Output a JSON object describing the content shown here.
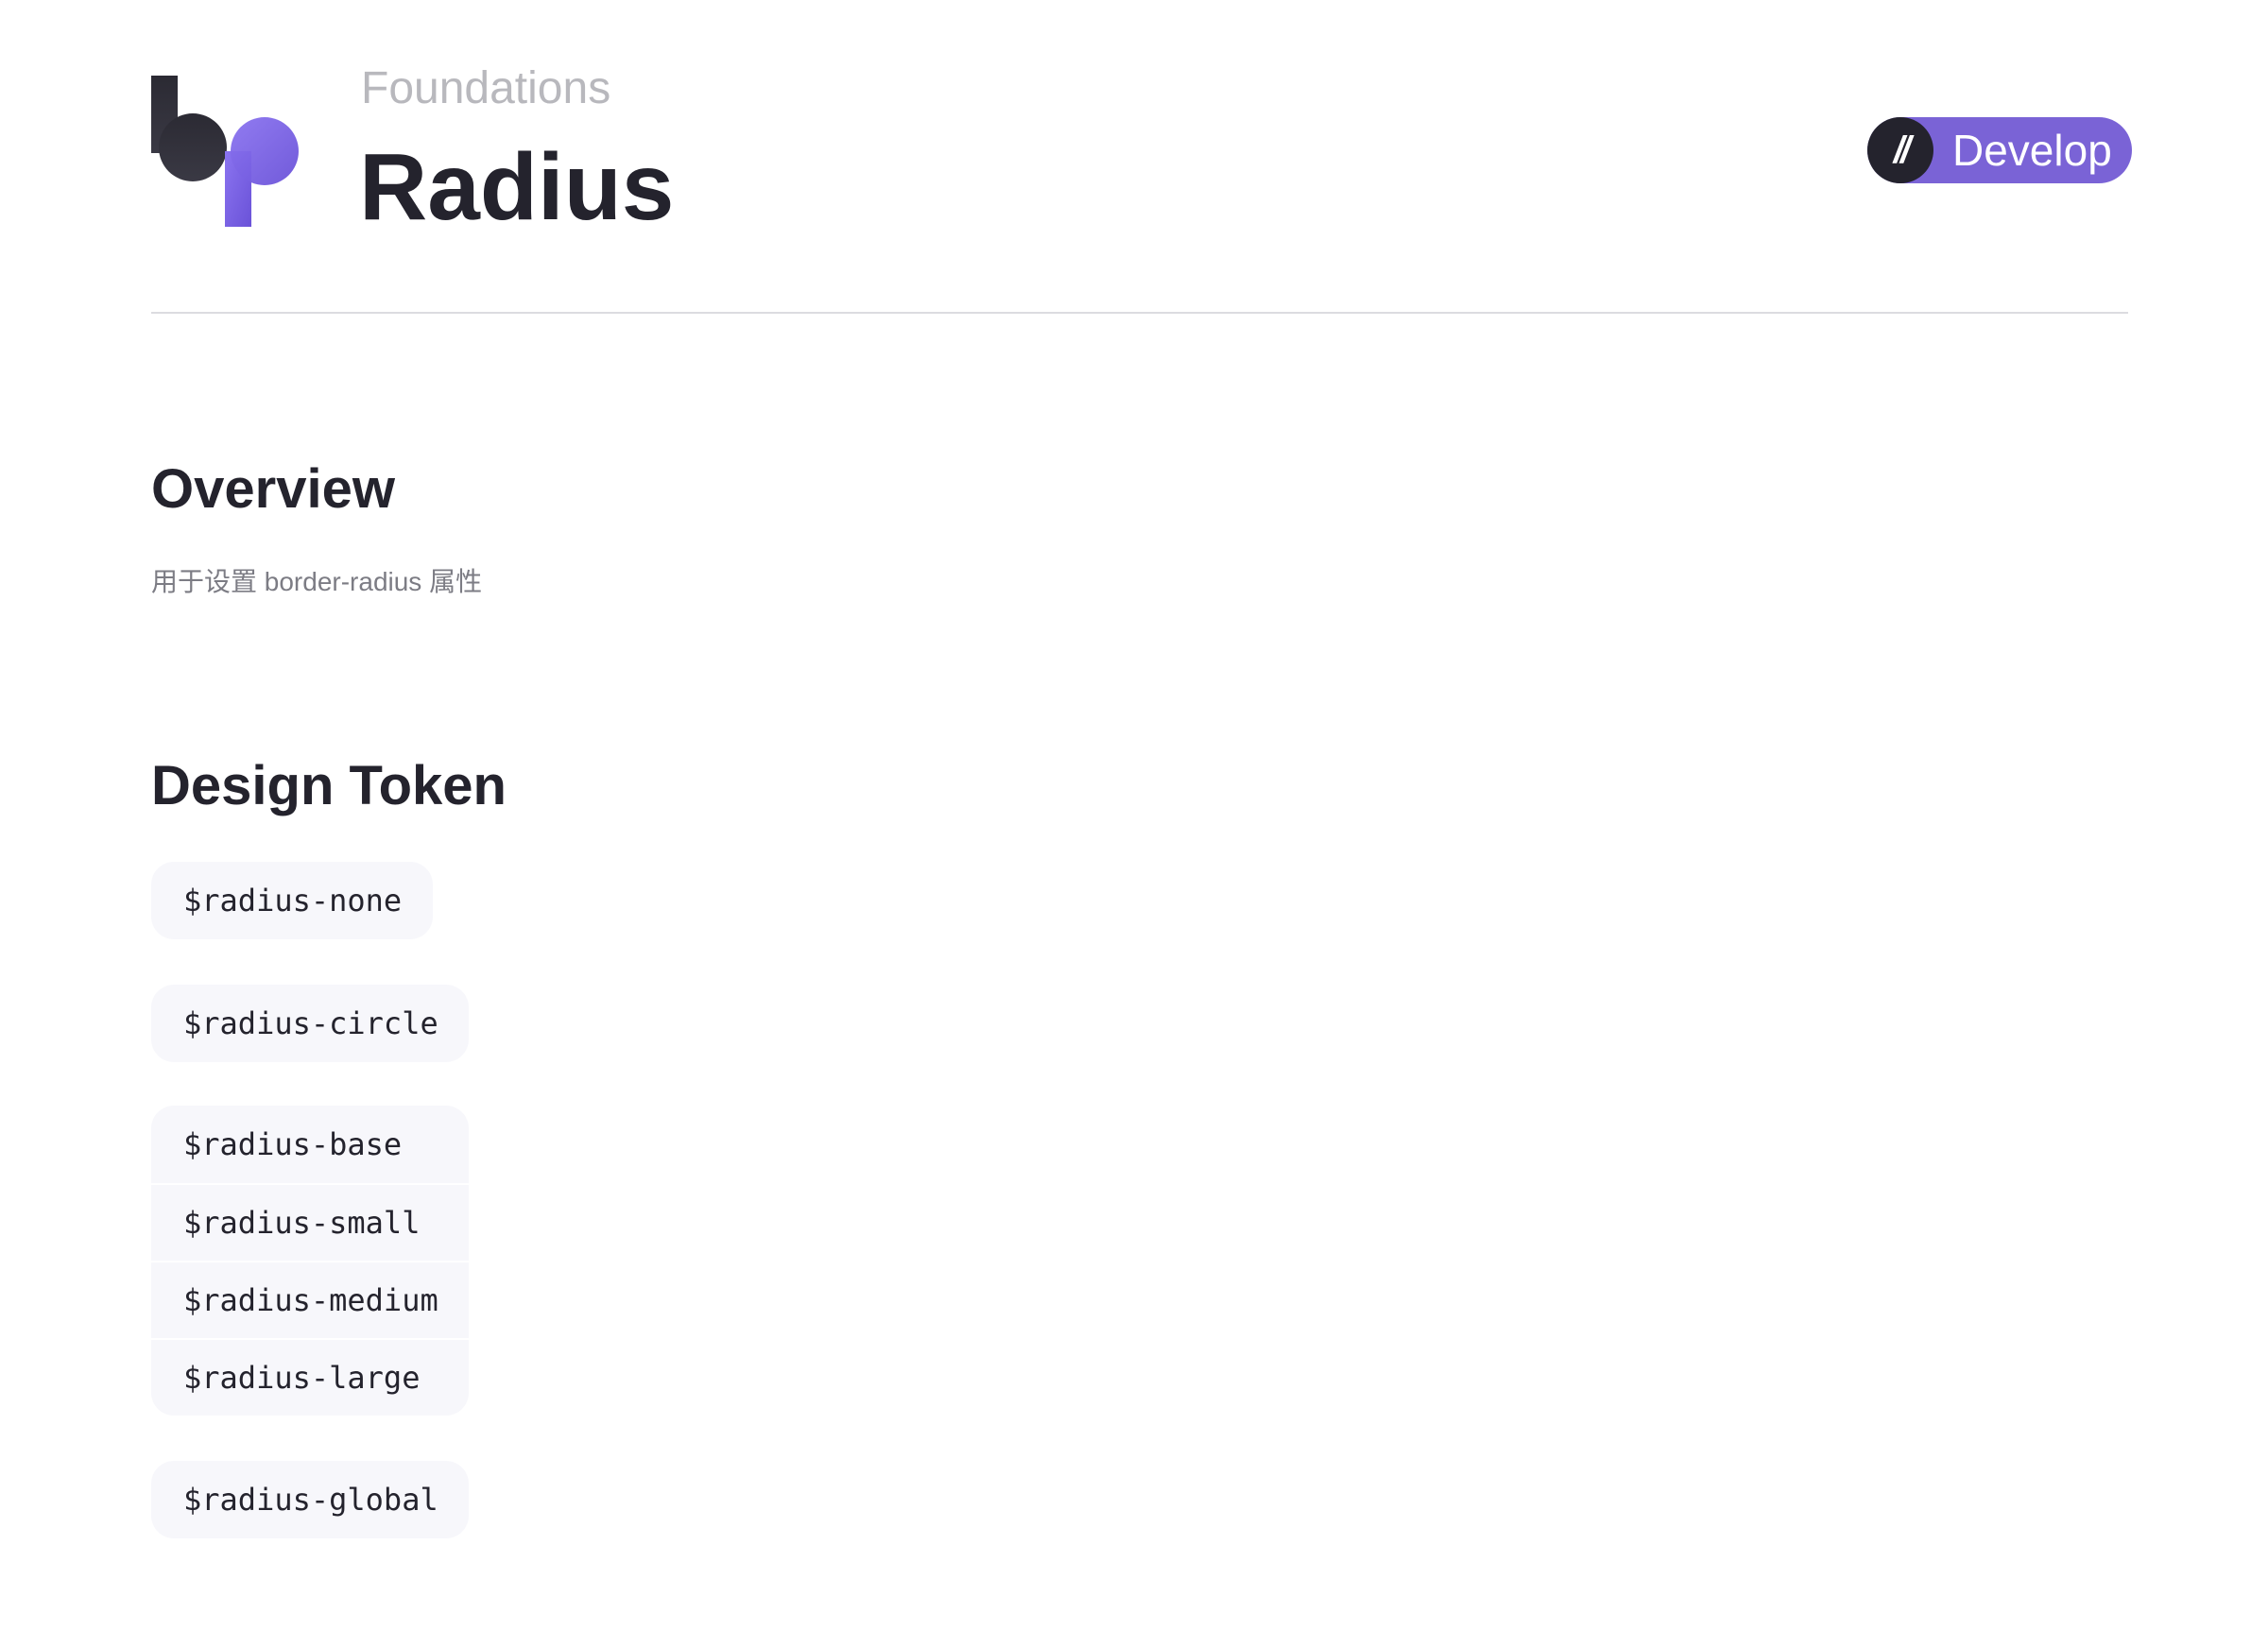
{
  "header": {
    "logo_icon": "bp-logo-icon",
    "subtitle": "Foundations",
    "title": "Radius",
    "badge": {
      "icon": "//",
      "label": "Develop",
      "color": "#7a63d6"
    }
  },
  "overview": {
    "heading": "Overview",
    "description": "用于设置 border-radius 属性"
  },
  "design_token": {
    "heading": "Design Token",
    "tokens": {
      "none": "$radius-none",
      "circle": "$radius-circle",
      "base": "$radius-base",
      "small": "$radius-small",
      "medium": "$radius-medium",
      "large": "$radius-large",
      "global": "$radius-global"
    }
  },
  "colors": {
    "accent": "#7a63d6",
    "text": "#24232d",
    "muted": "#b8b8bd",
    "chip_bg": "#f7f7fb"
  }
}
